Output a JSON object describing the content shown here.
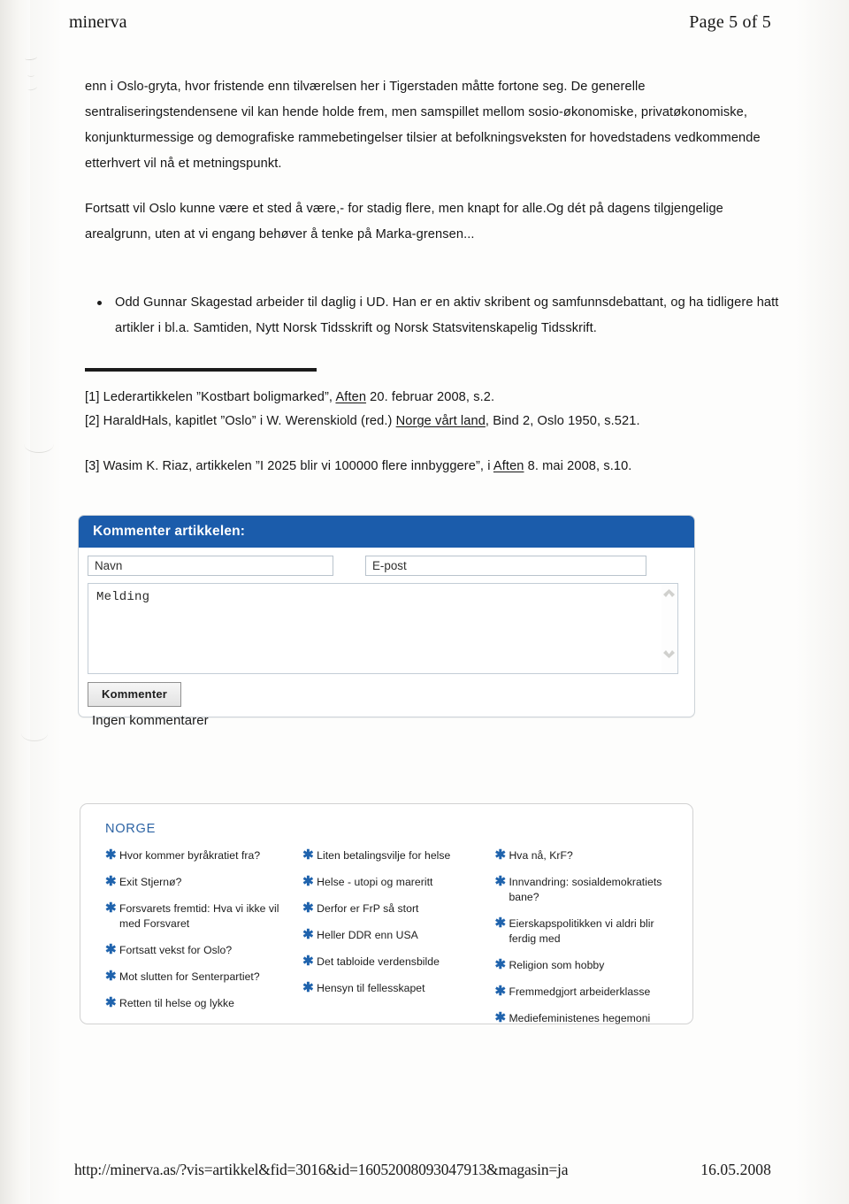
{
  "header": {
    "site": "minerva",
    "page_indicator": "Page 5 of 5"
  },
  "article": {
    "paragraphs": [
      "enn i Oslo-gryta, hvor fristende enn tilværelsen her i Tigerstaden måtte fortone seg. De generelle sentraliseringstendensene vil kan hende holde frem, men samspillet mellom sosio-økonomiske, privatøkonomiske, konjunkturmessige og demografiske rammebetingelser tilsier at befolkningsveksten for hovedstadens vedkommende etterhvert vil nå et metningspunkt.",
      "Fortsatt vil Oslo kunne være et sted å være,- for stadig flere, men knapt for alle.Og dét på dagens tilgjengelige arealgrunn, uten at vi engang behøver å tenke på Marka-grensen..."
    ],
    "bio_note": "Odd Gunnar Skagestad arbeider til daglig i UD. Han er en aktiv skribent og samfunnsdebattant, og ha tidligere hatt artikler i bl.a. Samtiden, Nytt Norsk Tidsskrift og Norsk Statsvitenskapelig Tidsskrift."
  },
  "references": {
    "ref1": {
      "prefix": "[1] Lederartikkelen ”Kostbart boligmarked”, ",
      "italic": "Aften",
      "suffix": " 20. februar 2008, s.2."
    },
    "ref2": {
      "prefix": "[2] HaraldHals, kapitlet ”Oslo” i W. Werenskiold (red.) ",
      "italic": "Norge vårt land",
      "suffix": ", Bind 2, Oslo 1950, s.521."
    },
    "ref3": {
      "prefix": "[3] Wasim K. Riaz, artikkelen ”I 2025 blir vi 100000 flere innbyggere”, i ",
      "italic": "Aften",
      "suffix": " 8. mai 2008, s.10."
    }
  },
  "comment_form": {
    "title": "Kommenter artikkelen:",
    "name_value": "Navn",
    "email_value": "E-post",
    "message_value": "Melding",
    "submit_label": "Kommenter",
    "scroll_up_icon": "chevron-up-icon",
    "scroll_down_icon": "chevron-down-icon",
    "header_color": "#1b5cab"
  },
  "comments": {
    "empty_text": "Ingen kommentarer"
  },
  "norge_box": {
    "title": "NORGE",
    "accent_color": "#1f63ad",
    "bullet_icon": "star-bullet-icon",
    "columns": [
      {
        "links": [
          "Hvor kommer byråkratiet fra?",
          "Exit Stjernø?",
          "Forsvarets fremtid: Hva vi ikke vil med Forsvaret",
          "Fortsatt vekst for Oslo?",
          "Mot slutten for Senterpartiet?",
          "Retten til helse og lykke"
        ]
      },
      {
        "links": [
          "Liten betalingsvilje for helse",
          "Helse - utopi og mareritt",
          "Derfor er FrP så stort",
          "Heller DDR enn USA",
          "Det tabloide verdensbilde",
          "Hensyn til fellesskapet"
        ]
      },
      {
        "links": [
          "Hva nå, KrF?",
          "Innvandring: sosialdemokratiets bane?",
          "Eierskapspolitikken vi aldri blir ferdig med",
          "Religion som hobby",
          "Fremmedgjort arbeiderklasse",
          "Mediefeministenes hegemoni"
        ]
      }
    ]
  },
  "footer": {
    "url": "http://minerva.as/?vis=artikkel&fid=3016&id=16052008093047913&magasin=ja",
    "date": "16.05.2008"
  }
}
